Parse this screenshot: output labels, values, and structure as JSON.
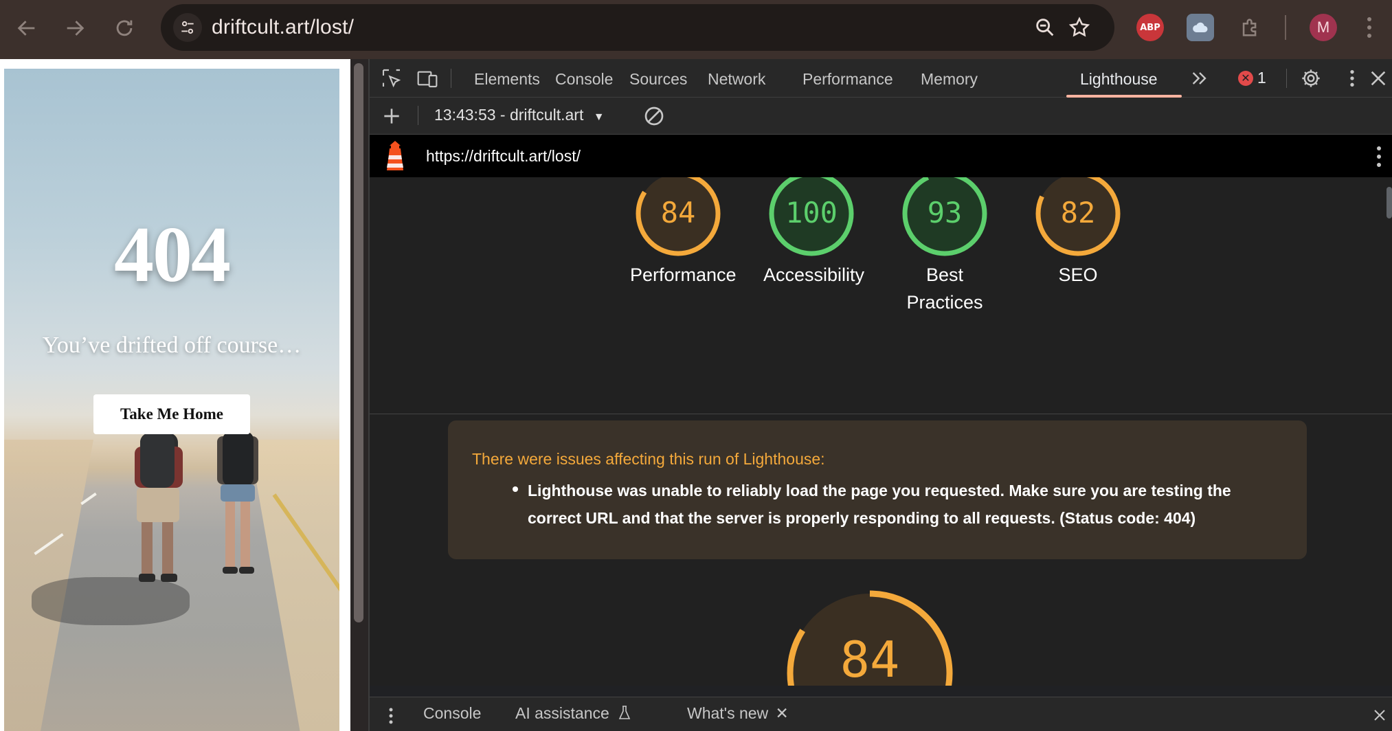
{
  "browser": {
    "url": "driftcult.art/lost/",
    "profile_initial": "M",
    "extensions": {
      "adblock_label": "ABP"
    }
  },
  "webpage": {
    "headline": "404",
    "message": "You’ve drifted off course…",
    "home_button_label": "Take Me Home"
  },
  "devtools": {
    "tabs": [
      "Elements",
      "Console",
      "Sources",
      "Network",
      "Performance",
      "Memory",
      "Lighthouse"
    ],
    "active_tab": "Lighthouse",
    "error_count": "1",
    "report_select": "13:43:53 - driftcult.art",
    "lighthouse_url": "https://driftcult.art/lost/",
    "scores": [
      {
        "label": "Performance",
        "value": "84",
        "color": "#f4a93b"
      },
      {
        "label": "Accessibility",
        "value": "100",
        "color": "#5ccf6c"
      },
      {
        "label": "Best Practices",
        "value": "93",
        "color": "#5ccf6c"
      },
      {
        "label": "SEO",
        "value": "82",
        "color": "#f4a93b"
      }
    ],
    "warning_title": "There were issues affecting this run of Lighthouse:",
    "warning_item": "Lighthouse was unable to reliably load the page you requested. Make sure you are testing the correct URL and that the server is properly responding to all requests. (Status code: 404)",
    "big_score": "84",
    "drawer_tabs": {
      "console": "Console",
      "ai": "AI assistance",
      "whats_new": "What's new"
    }
  }
}
